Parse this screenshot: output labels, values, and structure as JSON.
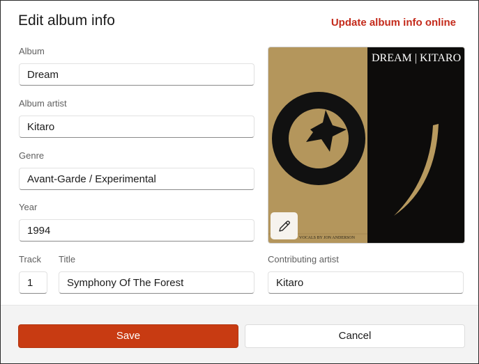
{
  "dialog": {
    "title": "Edit album info",
    "update_link": "Update album info online"
  },
  "fields": {
    "album": {
      "label": "Album",
      "value": "Dream"
    },
    "album_artist": {
      "label": "Album artist",
      "value": "Kitaro"
    },
    "genre": {
      "label": "Genre",
      "value": "Avant-Garde / Experimental"
    },
    "year": {
      "label": "Year",
      "value": "1994"
    },
    "track": {
      "label": "Track",
      "value": "1"
    },
    "title": {
      "label": "Title",
      "value": "Symphony Of The Forest"
    },
    "contributing_artist": {
      "label": "Contributing artist",
      "value": "Kitaro"
    }
  },
  "cover": {
    "text_top": "DREAM | KITARO",
    "text_bottom": "VOCALS BY JON ANDERSON",
    "edit_icon": "pencil-icon"
  },
  "buttons": {
    "save": "Save",
    "cancel": "Cancel"
  },
  "colors": {
    "accent": "#c42b1c",
    "save_bg": "#c83b12",
    "cover_tan": "#b89a5f",
    "cover_black": "#0d0c0b"
  }
}
